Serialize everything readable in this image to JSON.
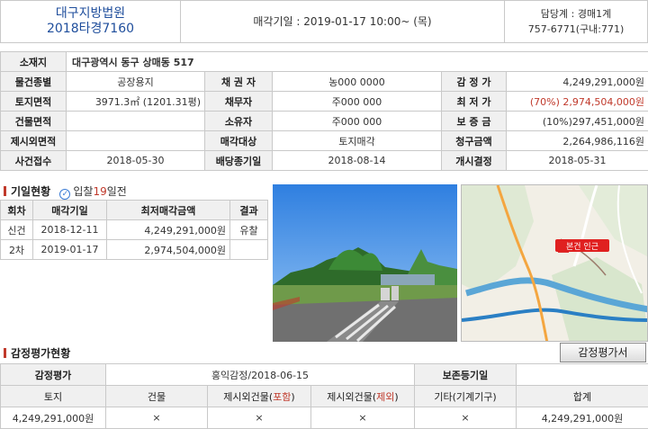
{
  "header": {
    "court_name": "대구지방법원",
    "case_number": "2018타경7160",
    "sale_date_text": "매각기일 : 2019-01-17   10:00~ (목)",
    "team_label": "담당계 : 경매1계",
    "team_phone": "757-6771(구내:771)"
  },
  "info": {
    "address_label": "소재지",
    "address": "대구광역시 동구 상매동 517",
    "rows": [
      {
        "l1": "물건종별",
        "v1": "공장용지",
        "l2": "채 권 자",
        "v2": "농000 0000",
        "l3": "감 정 가",
        "v3": "4,249,291,000원",
        "v3_red": ""
      },
      {
        "l1": "토지면적",
        "v1": "3971.3㎡ (1201.31평)",
        "l2": "채무자",
        "v2": "주000 000",
        "l3": "최 저 가",
        "v3": "(70%) 2,974,504,000원",
        "v3_red": "true"
      },
      {
        "l1": "건물면적",
        "v1": "",
        "l2": "소유자",
        "v2": "주000 000",
        "l3": "보 증 금",
        "v3": "(10%)297,451,000원",
        "v3_red": ""
      },
      {
        "l1": "제시외면적",
        "v1": "",
        "l2": "매각대상",
        "v2": "토지매각",
        "l3": "청구금액",
        "v3": "2,264,986,116원",
        "v3_red": ""
      },
      {
        "l1": "사건접수",
        "v1": "2018-05-30",
        "l2": "배당종기일",
        "v2": "2018-08-14",
        "l3": "개시결정",
        "v3": "2018-05-31",
        "v3_red": ""
      }
    ]
  },
  "history": {
    "title": "기일현황",
    "badge_prefix": "입찰",
    "badge_days": "19",
    "badge_suffix": "일전",
    "headers": [
      "회차",
      "매각기일",
      "최저매각금액",
      "결과"
    ],
    "rows": [
      [
        "신건",
        "2018-12-11",
        "4,249,291,000원",
        "유찰"
      ],
      [
        "2차",
        "2019-01-17",
        "2,974,504,000원",
        ""
      ]
    ]
  },
  "map": {
    "pin_label": "본건 인근"
  },
  "appraisal": {
    "title": "감정평가현황",
    "button_label": "감정평가서",
    "row1": {
      "label": "감정평가",
      "org": "홍익감정/2018-06-15",
      "label2": "보존등기일",
      "value2": ""
    },
    "headers": [
      "토지",
      "건물",
      "제시외건물(포함)",
      "제시외건물(제외)",
      "기타(기계기구)",
      "합계"
    ],
    "values": [
      "4,249,291,000원",
      "×",
      "×",
      "×",
      "×",
      "4,249,291,000원"
    ]
  },
  "colors": {
    "accent": "#1f4e9c",
    "red": "#c0392b"
  }
}
